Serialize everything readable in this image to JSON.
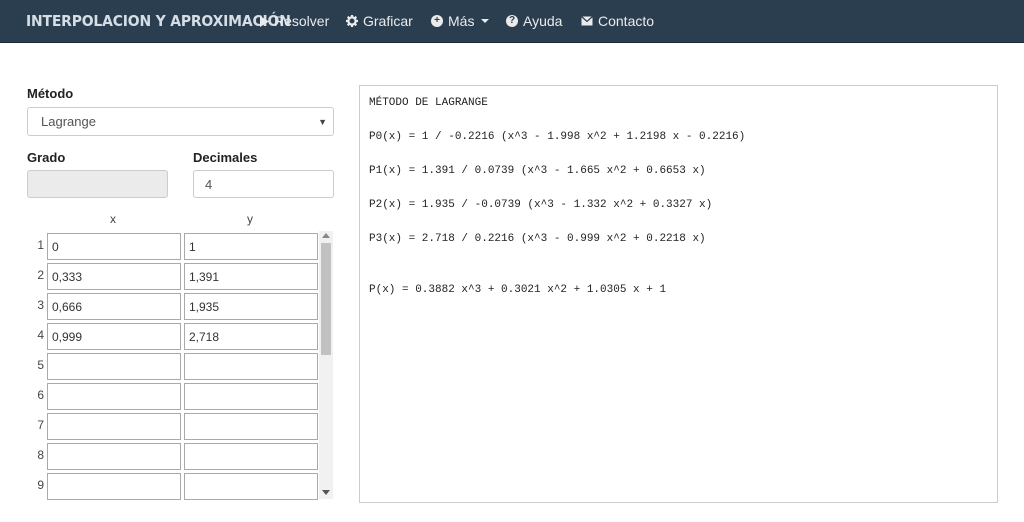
{
  "navbar": {
    "brand": "INTERPOLACION Y APROXIMACIÓN",
    "items": [
      {
        "label": "Resolver",
        "icon": "play-icon"
      },
      {
        "label": "Graficar",
        "icon": "gear-icon"
      },
      {
        "label": "Más",
        "icon": "plus-circle-icon"
      },
      {
        "label": "Ayuda",
        "icon": "question-circle-icon"
      },
      {
        "label": "Contacto",
        "icon": "envelope-icon"
      }
    ]
  },
  "form": {
    "metodo_label": "Método",
    "metodo_value": "Lagrange",
    "grado_label": "Grado",
    "grado_value": "",
    "decimales_label": "Decimales",
    "decimales_value": "4"
  },
  "table": {
    "headers": [
      "x",
      "y"
    ],
    "rows": [
      {
        "n": "1",
        "x": "0",
        "y": "1"
      },
      {
        "n": "2",
        "x": "0,333",
        "y": "1,391"
      },
      {
        "n": "3",
        "x": "0,666",
        "y": "1,935"
      },
      {
        "n": "4",
        "x": "0,999",
        "y": "2,718"
      },
      {
        "n": "5",
        "x": "",
        "y": ""
      },
      {
        "n": "6",
        "x": "",
        "y": ""
      },
      {
        "n": "7",
        "x": "",
        "y": ""
      },
      {
        "n": "8",
        "x": "",
        "y": ""
      },
      {
        "n": "9",
        "x": "",
        "y": ""
      }
    ]
  },
  "output": {
    "lines": [
      "MÉTODO DE LAGRANGE",
      "P0(x) = 1 / -0.2216 (x^3 - 1.998 x^2 + 1.2198 x - 0.2216)",
      "P1(x) = 1.391 / 0.0739 (x^3 - 1.665 x^2 + 0.6653 x)",
      "P2(x) = 1.935 / -0.0739 (x^3 - 1.332 x^2 + 0.3327 x)",
      "P3(x) = 2.718 / 0.2216 (x^3 - 0.999 x^2 + 0.2218 x)",
      "P(x) = 0.3882 x^3 + 0.3021 x^2 + 1.0305 x + 1"
    ]
  }
}
